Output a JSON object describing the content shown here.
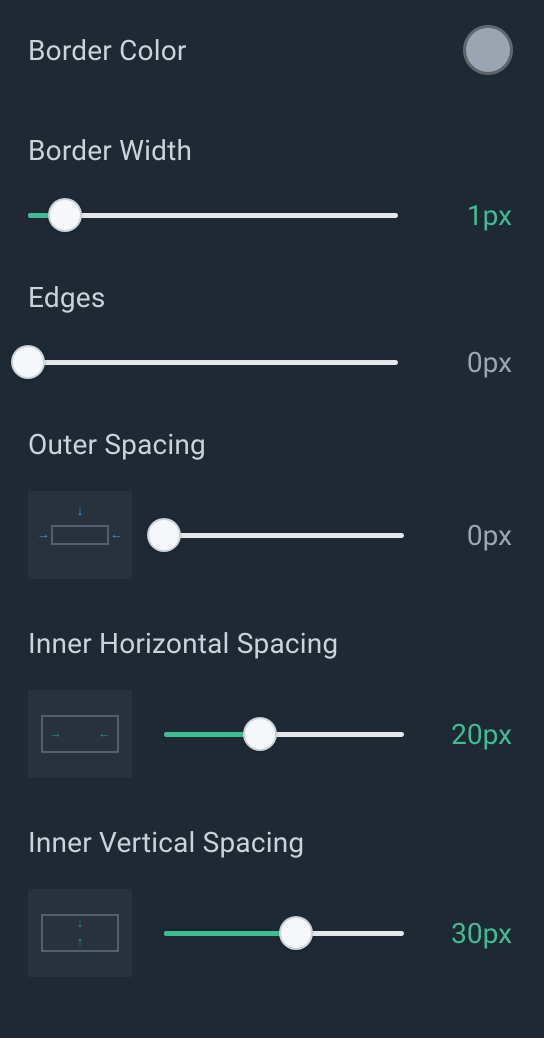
{
  "border_color": {
    "label": "Border Color",
    "swatch_hex": "#9aa5b1"
  },
  "border_width": {
    "label": "Border Width",
    "value_text": "1px",
    "value": 1,
    "min": 0,
    "max": 10,
    "fill_percent": 10,
    "active": true
  },
  "edges": {
    "label": "Edges",
    "value_text": "0px",
    "value": 0,
    "min": 0,
    "max": 50,
    "fill_percent": 0,
    "active": false
  },
  "outer_spacing": {
    "label": "Outer Spacing",
    "value_text": "0px",
    "value": 0,
    "min": 0,
    "max": 50,
    "fill_percent": 0,
    "active": false
  },
  "inner_h_spacing": {
    "label": "Inner Horizontal Spacing",
    "value_text": "20px",
    "value": 20,
    "min": 0,
    "max": 50,
    "fill_percent": 40,
    "active": true
  },
  "inner_v_spacing": {
    "label": "Inner Vertical Spacing",
    "value_text": "30px",
    "value": 30,
    "min": 0,
    "max": 55,
    "fill_percent": 55,
    "active": true
  }
}
